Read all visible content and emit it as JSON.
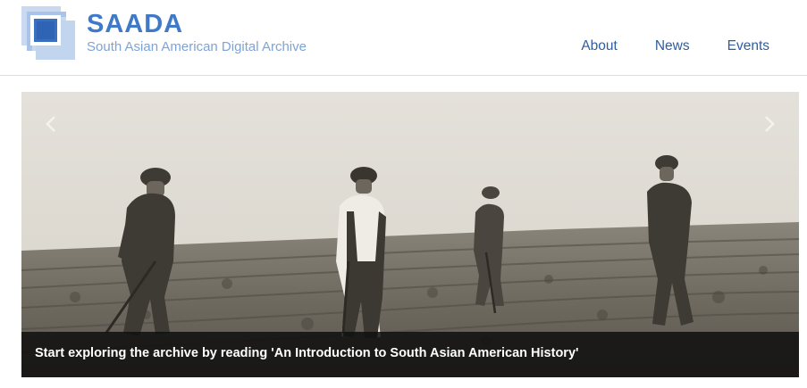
{
  "brand": {
    "title": "SAADA",
    "subtitle": "South Asian American Digital Archive"
  },
  "nav": {
    "items": [
      {
        "label": "About"
      },
      {
        "label": "News"
      },
      {
        "label": "Events"
      }
    ]
  },
  "carousel": {
    "caption": "Start exploring the archive by reading 'An Introduction to South Asian American History'",
    "prev_icon": "chevron-left-icon",
    "next_icon": "chevron-right-icon"
  },
  "colors": {
    "brand": "#3f79c8",
    "subtitle": "#7ea3d6",
    "nav": "#2f5d9e",
    "caption_bg": "#0f0f0f"
  }
}
